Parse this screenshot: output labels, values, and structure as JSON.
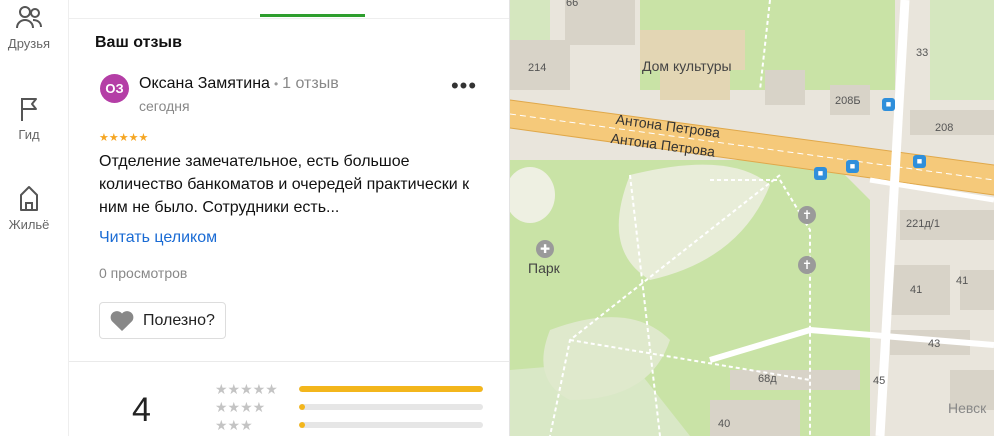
{
  "rail": {
    "items": [
      {
        "label": "Друзья",
        "icon": "friends-icon"
      },
      {
        "label": "Гид",
        "icon": "flag-icon"
      },
      {
        "label": "Жильё",
        "icon": "house-icon"
      }
    ]
  },
  "review": {
    "section_title": "Ваш отзыв",
    "avatar_initials": "ОЗ",
    "author": "Оксана Замятина",
    "separator": "•",
    "review_count": "1 отзыв",
    "date": "сегодня",
    "rating_stars": "★★★★★",
    "text": "Отделение замечательное, есть большое количество банкоматов и очередей практически к ним не было. Сотрудники есть...",
    "read_more": "Читать целиком",
    "views": "0 просмотров",
    "helpful": "Полезно?",
    "more_symbol": "•••"
  },
  "rating_summary": {
    "average": "4",
    "distribution": [
      {
        "stars": "★★★★★",
        "fraction": 1.0
      },
      {
        "stars": "★★★★",
        "fraction": 0.03
      },
      {
        "stars": "★★★",
        "fraction": 0.03
      }
    ]
  },
  "map": {
    "labels": {
      "house_of_culture": "Дом культуры",
      "park": "Парк",
      "street_1": "Антона Петрова",
      "street_2": "Антона Петрова",
      "street_nevsk": "Невск",
      "b66": "66",
      "b214": "214",
      "b33": "33",
      "b208b": "208Б",
      "b208": "208",
      "b221d1": "221д/1",
      "b41": "41",
      "b41b": "41",
      "b43": "43",
      "b45": "45",
      "b68d": "68д",
      "b40": "40"
    },
    "colors": {
      "park": "#c9e3a6",
      "road": "#f5c97a",
      "building": "#d8d3c8"
    }
  }
}
